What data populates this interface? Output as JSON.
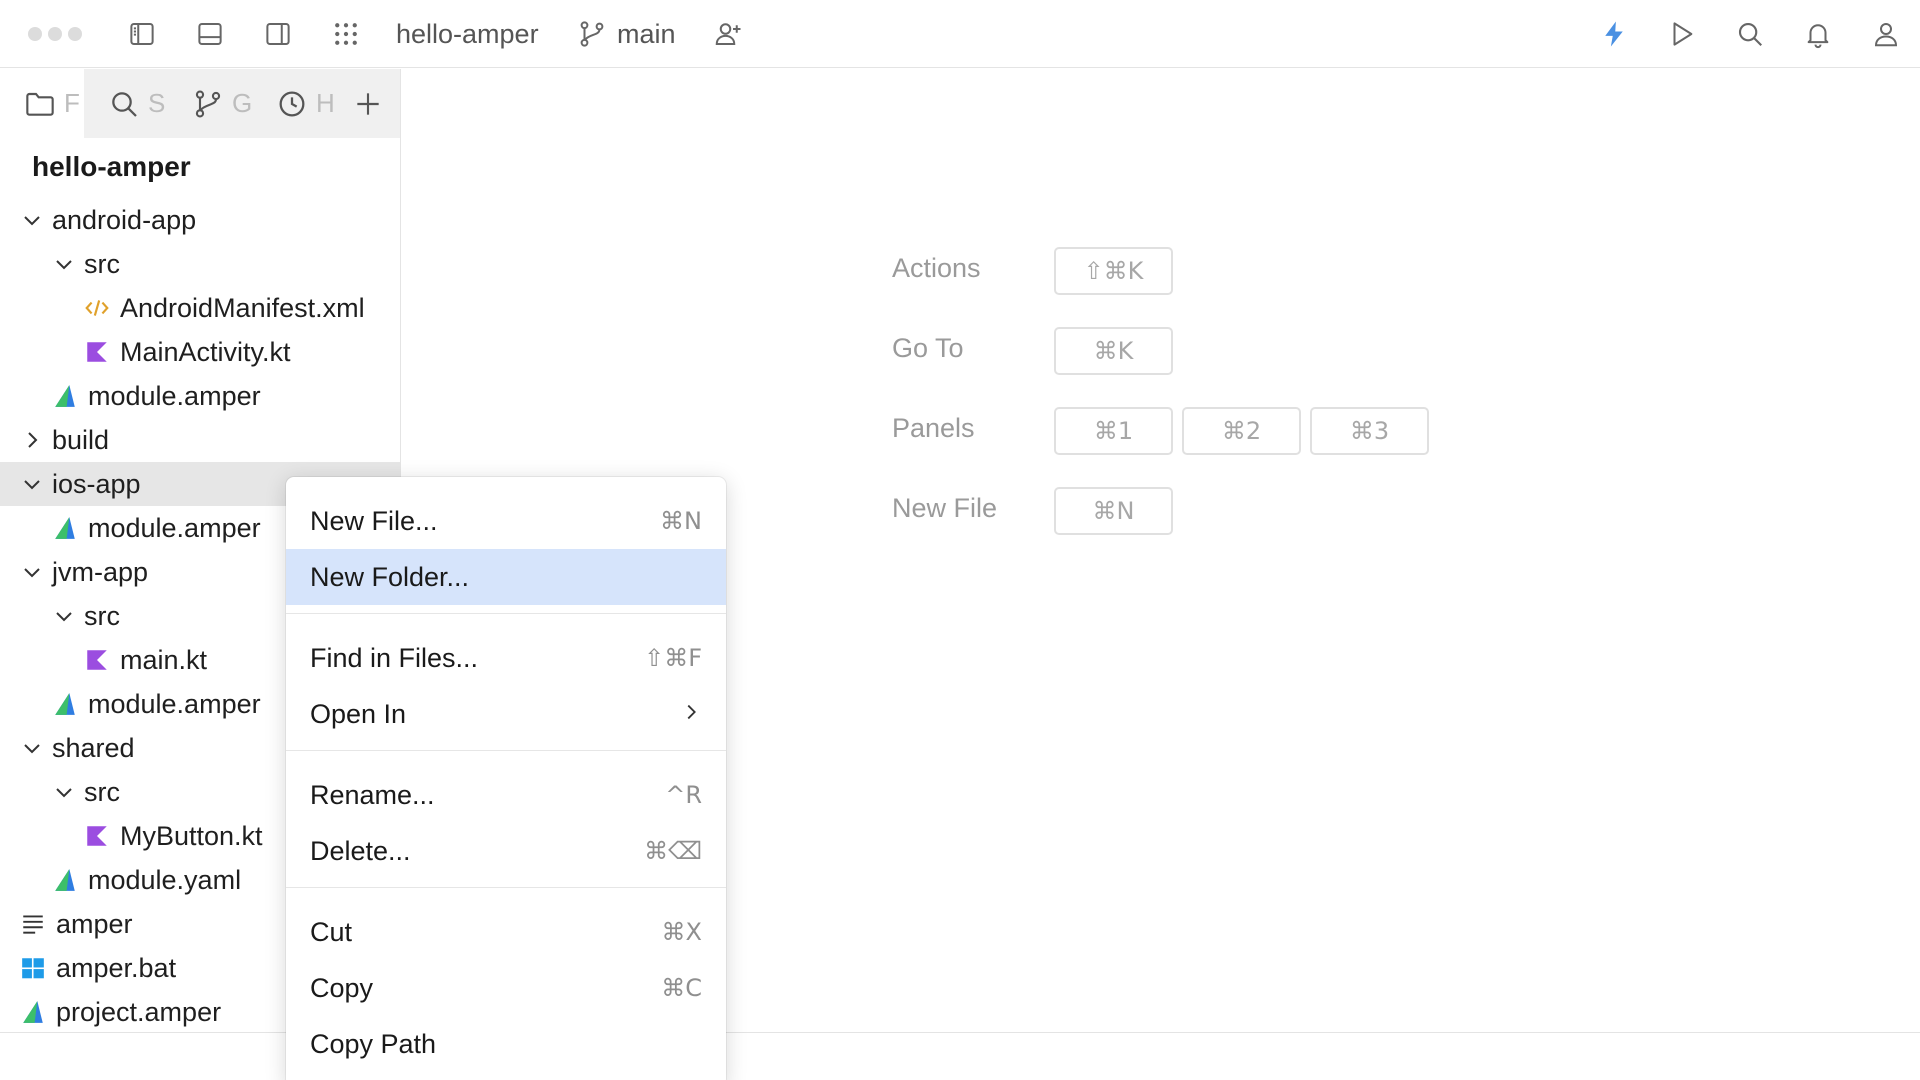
{
  "titlebar": {
    "project": "hello-amper",
    "branch": "main"
  },
  "sidebar": {
    "tabs": [
      {
        "label": "F",
        "icon": "folder-icon"
      },
      {
        "label": "S",
        "icon": "search-icon"
      },
      {
        "label": "G",
        "icon": "git-branch-icon"
      },
      {
        "label": "H",
        "icon": "history-icon"
      }
    ],
    "project_title": "hello-amper",
    "tree": [
      {
        "label": "android-app",
        "depth": 0,
        "expander": "open",
        "icon": ""
      },
      {
        "label": "src",
        "depth": 1,
        "expander": "open",
        "icon": ""
      },
      {
        "label": "AndroidManifest.xml",
        "depth": 2,
        "expander": "",
        "icon": "xml-file-icon"
      },
      {
        "label": "MainActivity.kt",
        "depth": 2,
        "expander": "",
        "icon": "kotlin-file-icon"
      },
      {
        "label": "module.amper",
        "depth": 1,
        "expander": "",
        "icon": "amper-file-icon"
      },
      {
        "label": "build",
        "depth": 0,
        "expander": "closed",
        "icon": ""
      },
      {
        "label": "ios-app",
        "depth": 0,
        "expander": "open",
        "icon": "",
        "selected": true
      },
      {
        "label": "module.amper",
        "depth": 1,
        "expander": "",
        "icon": "amper-file-icon"
      },
      {
        "label": "jvm-app",
        "depth": 0,
        "expander": "open",
        "icon": ""
      },
      {
        "label": "src",
        "depth": 1,
        "expander": "open",
        "icon": ""
      },
      {
        "label": "main.kt",
        "depth": 2,
        "expander": "",
        "icon": "kotlin-file-icon"
      },
      {
        "label": "module.amper",
        "depth": 1,
        "expander": "",
        "icon": "amper-file-icon"
      },
      {
        "label": "shared",
        "depth": 0,
        "expander": "open",
        "icon": ""
      },
      {
        "label": "src",
        "depth": 1,
        "expander": "open",
        "icon": ""
      },
      {
        "label": "MyButton.kt",
        "depth": 2,
        "expander": "",
        "icon": "kotlin-file-icon"
      },
      {
        "label": "module.yaml",
        "depth": 1,
        "expander": "",
        "icon": "amper-file-icon"
      },
      {
        "label": "amper",
        "depth": 0,
        "expander": "",
        "icon": "text-file-icon"
      },
      {
        "label": "amper.bat",
        "depth": 0,
        "expander": "",
        "icon": "windows-file-icon"
      },
      {
        "label": "project.amper",
        "depth": 0,
        "expander": "",
        "icon": "amper-file-icon"
      }
    ]
  },
  "shortcuts": {
    "actions": {
      "label": "Actions",
      "keys": [
        "⇧⌘K"
      ]
    },
    "goto": {
      "label": "Go To",
      "keys": [
        "⌘K"
      ]
    },
    "panels": {
      "label": "Panels",
      "keys": [
        "⌘1",
        "⌘2",
        "⌘3"
      ]
    },
    "newfile": {
      "label": "New File",
      "keys": [
        "⌘N"
      ]
    }
  },
  "context_menu": {
    "items": [
      {
        "label": "New File...",
        "shortcut": "⌘N"
      },
      {
        "label": "New Folder...",
        "shortcut": "",
        "active": true
      },
      {
        "label": "Find in Files...",
        "shortcut": "⇧⌘F"
      },
      {
        "label": "Open In",
        "shortcut": "",
        "submenu": true
      },
      {
        "label": "Rename...",
        "shortcut": "^R"
      },
      {
        "label": "Delete...",
        "shortcut": "⌘⌫"
      },
      {
        "label": "Cut",
        "shortcut": "⌘X"
      },
      {
        "label": "Copy",
        "shortcut": "⌘C"
      },
      {
        "label": "Copy Path",
        "shortcut": ""
      }
    ]
  },
  "colors": {
    "accent_bolt": "#4a90e2",
    "menu_highlight": "#d6e4fb",
    "selected_row": "#e6e6e6",
    "kotlin_icon": "#9b4de0",
    "xml_icon": "#e0a12b",
    "amper_icon_green": "#3cbf6a",
    "amper_icon_blue": "#2f7de1",
    "windows_icon": "#1e9be8"
  }
}
